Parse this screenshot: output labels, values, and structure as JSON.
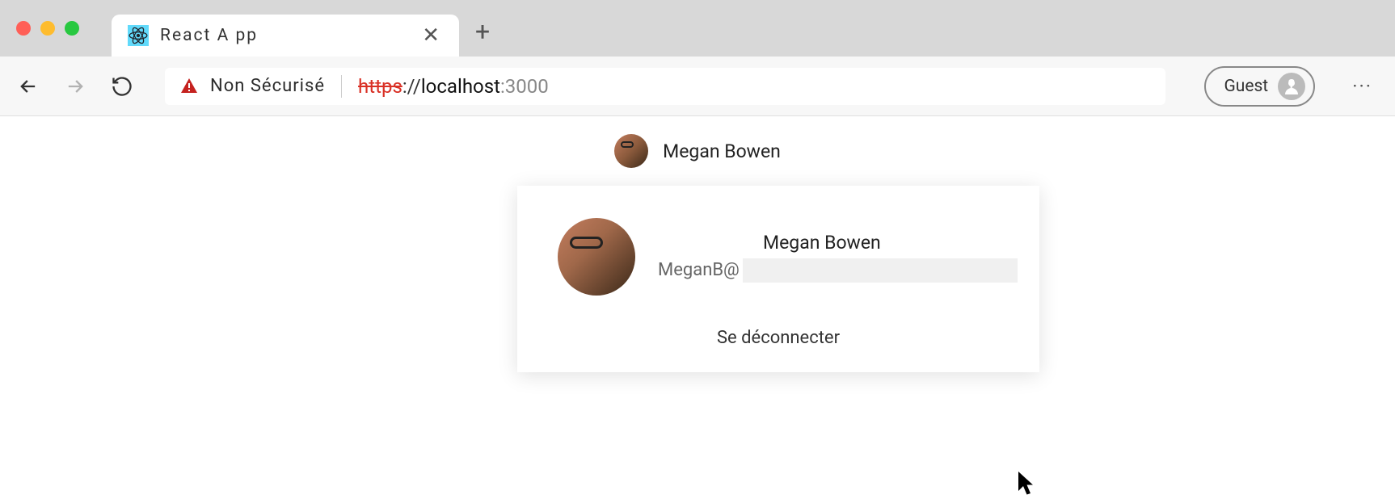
{
  "browser": {
    "tab": {
      "title": "React A  pp"
    },
    "security_label": "Non  Sécurisé",
    "url": {
      "protocol": "https",
      "host": "localhost",
      "port": ":3000"
    },
    "guest_label": "Guest"
  },
  "page": {
    "header_name": "Megan Bowen",
    "card": {
      "name": "Megan Bowen",
      "email_prefix": "MeganB@",
      "signout_label": "Se déconnecter"
    }
  }
}
